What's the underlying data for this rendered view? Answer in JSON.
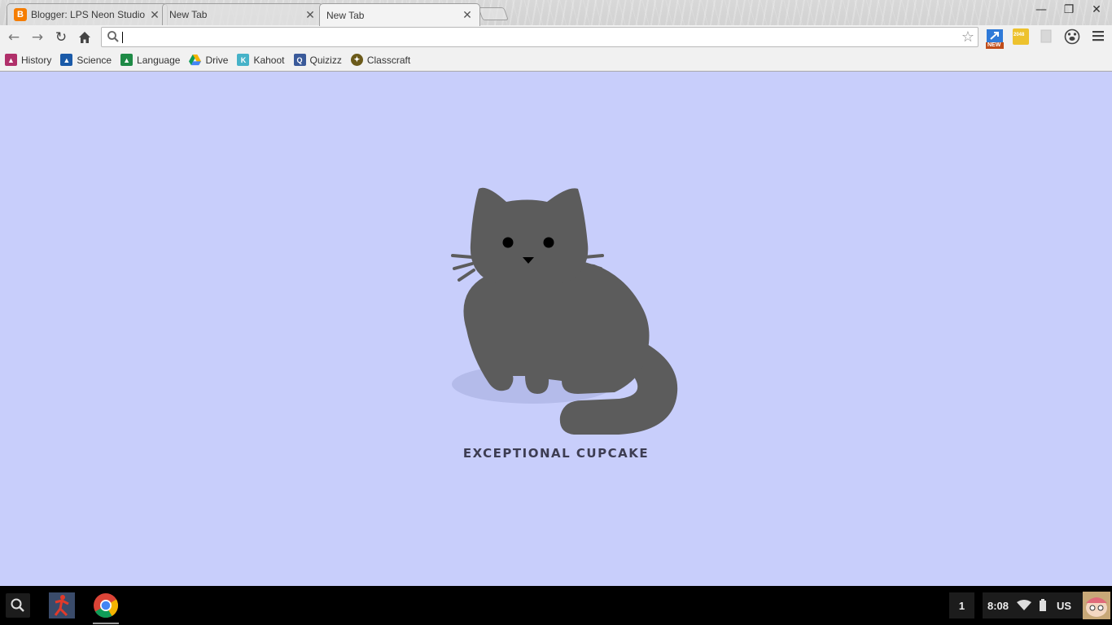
{
  "tabs": [
    {
      "title": "Blogger: LPS Neon Studio",
      "favicon": "B",
      "state": "inactive"
    },
    {
      "title": "New Tab",
      "state": "inactive"
    },
    {
      "title": "New Tab",
      "state": "active"
    }
  ],
  "window_controls": {
    "minimize": "—",
    "restore": "❐",
    "close": "✕"
  },
  "omnibox": {
    "value": "",
    "placeholder": ""
  },
  "extensions": [
    {
      "name": "new-extension-icon",
      "badge": "NEW"
    },
    {
      "name": "2048-icon",
      "label": "2048"
    }
  ],
  "bookmarks": [
    {
      "label": "History",
      "color": "#b0306a"
    },
    {
      "label": "Science",
      "color": "#1a5aa8"
    },
    {
      "label": "Language",
      "color": "#1e8a46"
    },
    {
      "label": "Drive",
      "color": "#f4b400"
    },
    {
      "label": "Kahoot",
      "color": "#46b2c8"
    },
    {
      "label": "Quizizz",
      "color": "#3a5a9a"
    },
    {
      "label": "Classcraft",
      "color": "#6b5a1a"
    }
  ],
  "page": {
    "caption": "EXCEPTIONAL CUPCAKE",
    "background_color": "#c8cefb",
    "cat_color": "#5c5c5c"
  },
  "shelf": {
    "notification_count": "1",
    "time": "8:08",
    "locale": "US"
  }
}
